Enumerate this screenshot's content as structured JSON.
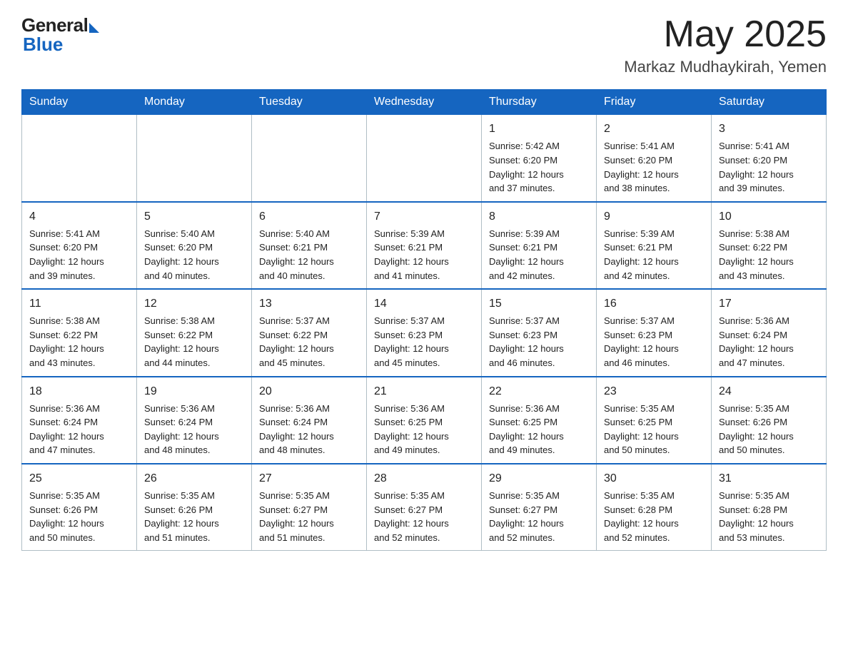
{
  "header": {
    "logo_general": "General",
    "logo_blue": "Blue",
    "month_year": "May 2025",
    "location": "Markaz Mudhaykirah, Yemen"
  },
  "days_of_week": [
    "Sunday",
    "Monday",
    "Tuesday",
    "Wednesday",
    "Thursday",
    "Friday",
    "Saturday"
  ],
  "weeks": [
    [
      {
        "day": "",
        "info": ""
      },
      {
        "day": "",
        "info": ""
      },
      {
        "day": "",
        "info": ""
      },
      {
        "day": "",
        "info": ""
      },
      {
        "day": "1",
        "info": "Sunrise: 5:42 AM\nSunset: 6:20 PM\nDaylight: 12 hours\nand 37 minutes."
      },
      {
        "day": "2",
        "info": "Sunrise: 5:41 AM\nSunset: 6:20 PM\nDaylight: 12 hours\nand 38 minutes."
      },
      {
        "day": "3",
        "info": "Sunrise: 5:41 AM\nSunset: 6:20 PM\nDaylight: 12 hours\nand 39 minutes."
      }
    ],
    [
      {
        "day": "4",
        "info": "Sunrise: 5:41 AM\nSunset: 6:20 PM\nDaylight: 12 hours\nand 39 minutes."
      },
      {
        "day": "5",
        "info": "Sunrise: 5:40 AM\nSunset: 6:20 PM\nDaylight: 12 hours\nand 40 minutes."
      },
      {
        "day": "6",
        "info": "Sunrise: 5:40 AM\nSunset: 6:21 PM\nDaylight: 12 hours\nand 40 minutes."
      },
      {
        "day": "7",
        "info": "Sunrise: 5:39 AM\nSunset: 6:21 PM\nDaylight: 12 hours\nand 41 minutes."
      },
      {
        "day": "8",
        "info": "Sunrise: 5:39 AM\nSunset: 6:21 PM\nDaylight: 12 hours\nand 42 minutes."
      },
      {
        "day": "9",
        "info": "Sunrise: 5:39 AM\nSunset: 6:21 PM\nDaylight: 12 hours\nand 42 minutes."
      },
      {
        "day": "10",
        "info": "Sunrise: 5:38 AM\nSunset: 6:22 PM\nDaylight: 12 hours\nand 43 minutes."
      }
    ],
    [
      {
        "day": "11",
        "info": "Sunrise: 5:38 AM\nSunset: 6:22 PM\nDaylight: 12 hours\nand 43 minutes."
      },
      {
        "day": "12",
        "info": "Sunrise: 5:38 AM\nSunset: 6:22 PM\nDaylight: 12 hours\nand 44 minutes."
      },
      {
        "day": "13",
        "info": "Sunrise: 5:37 AM\nSunset: 6:22 PM\nDaylight: 12 hours\nand 45 minutes."
      },
      {
        "day": "14",
        "info": "Sunrise: 5:37 AM\nSunset: 6:23 PM\nDaylight: 12 hours\nand 45 minutes."
      },
      {
        "day": "15",
        "info": "Sunrise: 5:37 AM\nSunset: 6:23 PM\nDaylight: 12 hours\nand 46 minutes."
      },
      {
        "day": "16",
        "info": "Sunrise: 5:37 AM\nSunset: 6:23 PM\nDaylight: 12 hours\nand 46 minutes."
      },
      {
        "day": "17",
        "info": "Sunrise: 5:36 AM\nSunset: 6:24 PM\nDaylight: 12 hours\nand 47 minutes."
      }
    ],
    [
      {
        "day": "18",
        "info": "Sunrise: 5:36 AM\nSunset: 6:24 PM\nDaylight: 12 hours\nand 47 minutes."
      },
      {
        "day": "19",
        "info": "Sunrise: 5:36 AM\nSunset: 6:24 PM\nDaylight: 12 hours\nand 48 minutes."
      },
      {
        "day": "20",
        "info": "Sunrise: 5:36 AM\nSunset: 6:24 PM\nDaylight: 12 hours\nand 48 minutes."
      },
      {
        "day": "21",
        "info": "Sunrise: 5:36 AM\nSunset: 6:25 PM\nDaylight: 12 hours\nand 49 minutes."
      },
      {
        "day": "22",
        "info": "Sunrise: 5:36 AM\nSunset: 6:25 PM\nDaylight: 12 hours\nand 49 minutes."
      },
      {
        "day": "23",
        "info": "Sunrise: 5:35 AM\nSunset: 6:25 PM\nDaylight: 12 hours\nand 50 minutes."
      },
      {
        "day": "24",
        "info": "Sunrise: 5:35 AM\nSunset: 6:26 PM\nDaylight: 12 hours\nand 50 minutes."
      }
    ],
    [
      {
        "day": "25",
        "info": "Sunrise: 5:35 AM\nSunset: 6:26 PM\nDaylight: 12 hours\nand 50 minutes."
      },
      {
        "day": "26",
        "info": "Sunrise: 5:35 AM\nSunset: 6:26 PM\nDaylight: 12 hours\nand 51 minutes."
      },
      {
        "day": "27",
        "info": "Sunrise: 5:35 AM\nSunset: 6:27 PM\nDaylight: 12 hours\nand 51 minutes."
      },
      {
        "day": "28",
        "info": "Sunrise: 5:35 AM\nSunset: 6:27 PM\nDaylight: 12 hours\nand 52 minutes."
      },
      {
        "day": "29",
        "info": "Sunrise: 5:35 AM\nSunset: 6:27 PM\nDaylight: 12 hours\nand 52 minutes."
      },
      {
        "day": "30",
        "info": "Sunrise: 5:35 AM\nSunset: 6:28 PM\nDaylight: 12 hours\nand 52 minutes."
      },
      {
        "day": "31",
        "info": "Sunrise: 5:35 AM\nSunset: 6:28 PM\nDaylight: 12 hours\nand 53 minutes."
      }
    ]
  ]
}
